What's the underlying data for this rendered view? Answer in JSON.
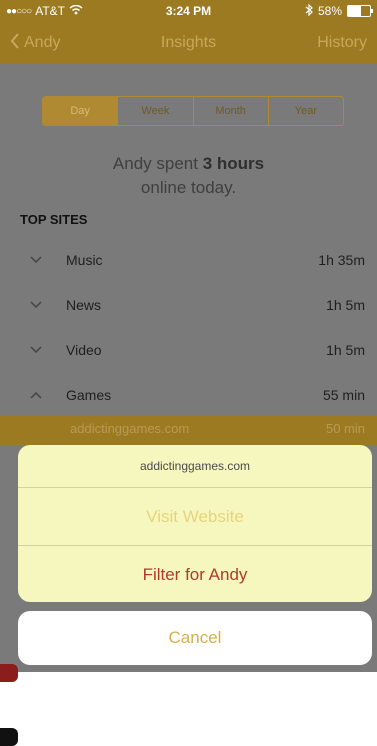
{
  "status": {
    "carrier": "AT&T",
    "time": "3:24 PM",
    "battery": "58%",
    "battery_level": 0.58,
    "icons": [
      "signal-dots-icon",
      "wifi-icon",
      "bluetooth-icon",
      "battery-icon"
    ]
  },
  "nav": {
    "back_label": "Andy",
    "title": "Insights",
    "right_label": "History"
  },
  "segments": [
    "Day",
    "Week",
    "Month",
    "Year"
  ],
  "selected_segment": "Day",
  "headline": {
    "prefix": "Andy spent ",
    "bold": "3 hours",
    "suffix": "online today."
  },
  "top_sites_label": "TOP SITES",
  "sites": [
    {
      "name": "Music",
      "time": "1h 35m",
      "expanded": false
    },
    {
      "name": "News",
      "time": "1h 5m",
      "expanded": false
    },
    {
      "name": "Video",
      "time": "1h 5m",
      "expanded": false
    },
    {
      "name": "Games",
      "time": "55 min",
      "expanded": true
    }
  ],
  "expanded_site": {
    "domain": "addictinggames.com",
    "time": "50 min"
  },
  "action_sheet": {
    "title": "addictinggames.com",
    "visit_label": "Visit Website",
    "filter_label": "Filter for Andy",
    "cancel_label": "Cancel"
  },
  "colors": {
    "brand_gold": "#9c7a22",
    "destructive": "#b0392e",
    "cancel_text": "#d3b04f"
  }
}
